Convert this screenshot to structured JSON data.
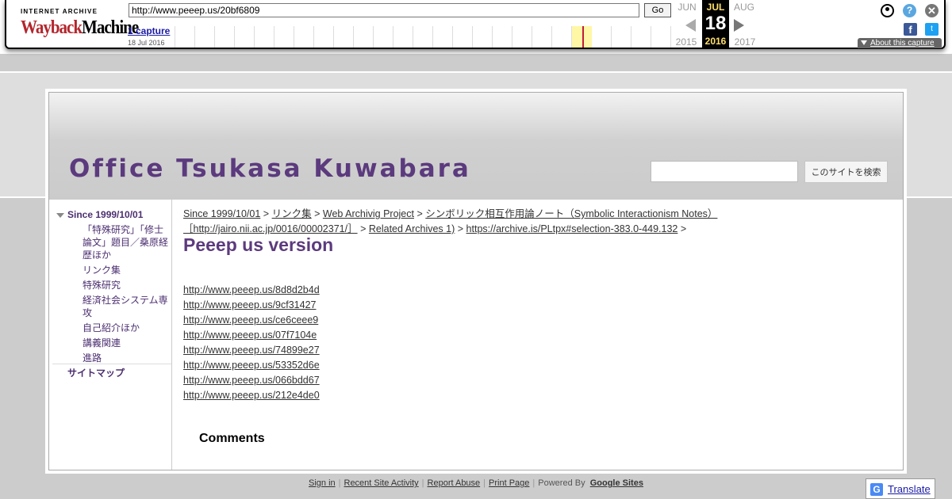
{
  "wayback": {
    "logo_top": "INTERNET ARCHIVE",
    "logo_wayback": "Wayback",
    "logo_machine": "Machine",
    "url": "http://www.peeep.us/20bf6809",
    "go_label": "Go",
    "captures_label": "1 capture",
    "capture_date": "18 Jul 2016",
    "prev_month": "JUN",
    "cur_month": "JUL",
    "next_month": "AUG",
    "cur_day": "18",
    "prev_year": "2015",
    "cur_year": "2016",
    "next_year": "2017",
    "help_glyph": "?",
    "close_glyph": "✕",
    "facebook_glyph": "f",
    "twitter_glyph": "t",
    "about_label": "About this capture"
  },
  "site": {
    "title": "Office Tsukasa Kuwabara",
    "search_button": "このサイトを検索",
    "search_placeholder": ""
  },
  "sidebar": {
    "top_item": "Since 1999/10/01",
    "items": [
      "「特殊研究」「修士論文」題目／桑原経歴ほか",
      "リンク集",
      "特殊研究",
      "経済社会システム専攻",
      "自己紹介ほか",
      "講義関連",
      "進路"
    ],
    "sitemap": "サイトマップ"
  },
  "content": {
    "breadcrumbs": [
      "Since 1999/10/01",
      "リンク集",
      "Web Archivig Project",
      "シンボリック相互作用論ノート（Symbolic Interactionism Notes）［http://jairo.nii.ac.jp/0016/00002371/］",
      "Related Archives 1)",
      "https://archive.is/PLtpx#selection-383.0-449.132"
    ],
    "crumb_sep": ">",
    "page_title": "Peeep us version",
    "links": [
      "http://www.peeep.us/8d8d2b4d",
      "http://www.peeep.us/9cf31427",
      "http://www.peeep.us/ce6ceee9",
      "http://www.peeep.us/07f7104e",
      "http://www.peeep.us/74899e27",
      "http://www.peeep.us/53352d6e",
      "http://www.peeep.us/066bdd67",
      "http://www.peeep.us/212e4de0"
    ],
    "comments_heading": "Comments"
  },
  "footer": {
    "sign_in": "Sign in",
    "recent": "Recent Site Activity",
    "report": "Report Abuse",
    "print": "Print Page",
    "powered_by": "Powered By",
    "google_sites": "Google Sites",
    "separator": "|"
  },
  "translate": {
    "label": "Translate",
    "glyph": "G"
  }
}
